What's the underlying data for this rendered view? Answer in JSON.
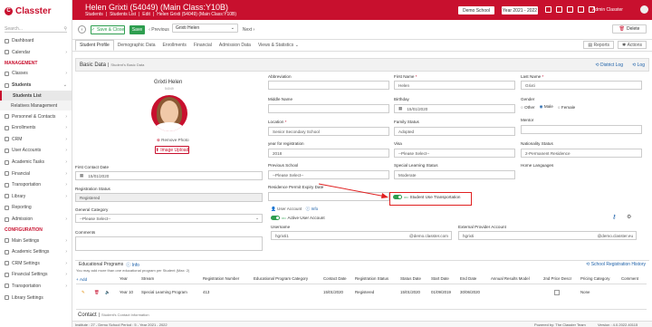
{
  "app": {
    "logo": "Classter",
    "logo_mark": "C"
  },
  "sidebar": {
    "search_placeholder": "Search...",
    "items_top": [
      {
        "label": "Dashboard"
      },
      {
        "label": "Calendar"
      }
    ],
    "section_management": "MANAGEMENT",
    "items_mgmt": [
      {
        "label": "Classes"
      },
      {
        "label": "Students"
      }
    ],
    "students_sub": [
      {
        "label": "Students List"
      },
      {
        "label": "Relatives Management"
      }
    ],
    "items_mgmt2": [
      {
        "label": "Personnel & Contacts"
      },
      {
        "label": "Enrollments"
      },
      {
        "label": "CRM"
      },
      {
        "label": "User Accounts"
      },
      {
        "label": "Academic Tasks"
      },
      {
        "label": "Financial"
      },
      {
        "label": "Transportation"
      },
      {
        "label": "Library"
      },
      {
        "label": "Reporting"
      },
      {
        "label": "Admission"
      }
    ],
    "section_configuration": "CONFIGURATION",
    "items_config": [
      {
        "label": "Main Settings"
      },
      {
        "label": "Academic Settings"
      },
      {
        "label": "CRM Settings"
      },
      {
        "label": "Financial Settings"
      },
      {
        "label": "Transportation"
      },
      {
        "label": "Library Settings"
      }
    ]
  },
  "header": {
    "title": "Helen Grixti (54049) (Main Class:Y10B)",
    "breadcrumb": [
      "Students",
      "Students List",
      "Edit",
      "Helen Grixti (54049) (Main Class:Y10B)"
    ],
    "school": "Demo School",
    "year": "Year 2021 - 2022",
    "user": "Admin Classter"
  },
  "toolbar": {
    "save_close": "Save & Close",
    "save": "Save",
    "previous": "Previous",
    "student_select": "Grixti Helen",
    "next": "Next",
    "delete": "Delete"
  },
  "tabs": [
    "Student Profile",
    "Demographic Data",
    "Enrollments",
    "Financial",
    "Admission Data",
    "Views & Statistics"
  ],
  "tab_right": {
    "reports": "Reports",
    "actions": "Actions"
  },
  "basic": {
    "title": "Basic Data",
    "subtitle": "Student's Basic Data",
    "district_log": "District Log",
    "log": "Log",
    "student_name": "Grixti Helen",
    "student_id": "54049",
    "remove_photo": "Remove Photo",
    "image_upload": "Image Upload",
    "first_contact_label": "First Contact Date",
    "first_contact": "15/01/2020",
    "reg_status_label": "Registration Status",
    "reg_status": "Registered",
    "general_category_label": "General Category",
    "general_category": "--Please Select--",
    "comments_label": "Comments"
  },
  "fields": {
    "abbreviation_label": "Abbreviation",
    "first_name_label": "First Name",
    "first_name": "Helen",
    "last_name_label": "Last Name",
    "last_name": "Grixti",
    "middle_name_label": "Middle Name",
    "birthday_label": "Birthday",
    "birthday": "15/01/2020",
    "gender_label": "Gender",
    "gender_options": [
      "Other",
      "Male",
      "Female"
    ],
    "gender_selected": "Male",
    "location_label": "Location",
    "location": "Senior Secondary School",
    "family_status_label": "Family Status",
    "family_status": "Adopted",
    "mentor_label": "Mentor",
    "year_reg_label": "year for registration",
    "year_reg": "2018",
    "visa_label": "Visa",
    "visa": "--Please Select--",
    "nationality_status_label": "Nationality Status",
    "nationality_status": "2-Permanent Residence",
    "previous_school_label": "Previous School",
    "previous_school": "--Please Select--",
    "special_learning_label": "Special Learning Status",
    "special_learning": "Moderate",
    "home_languages_label": "Home Languages",
    "residence_permit_label": "Residence Permit Expiry Date",
    "transport_label": "Student Use Transportation",
    "toggle_on": "ON"
  },
  "user_account": {
    "title": "User Account",
    "info": "Info",
    "active_label": "Active User Account",
    "username_label": "Username",
    "username": "hgrixti1",
    "domain": "@demo.classter.com",
    "ext_label": "External Provider Account",
    "ext_user": "hgrixti",
    "ext_domain": "@demo.classter.eu"
  },
  "edu": {
    "title": "Educational Programs",
    "info": "Info",
    "note": "You may add more than one educational program per Student (Max: 2)",
    "history": "School Registration History",
    "add": "Add",
    "columns": [
      "Year",
      "Stream",
      "Registration Number",
      "Educational Program Category",
      "Contact Date",
      "Registration Status",
      "Status Date",
      "Start Date",
      "End Date",
      "Annual Results Model",
      "2nd Price Descr",
      "Pricing Category",
      "Comment"
    ],
    "row": [
      "Year 10",
      "Special Learning Program",
      "413",
      "",
      "15/01/2020",
      "Registered",
      "15/01/2020",
      "01/09/2019",
      "30/06/2020",
      "",
      "",
      "None",
      ""
    ]
  },
  "contact": {
    "title": "Contact",
    "subtitle": "Student's Contact Information"
  },
  "footer": {
    "left": "Institute : 27 - Demo School  Period : 5 - Year 2021 - 2022",
    "right": "Powered by: The Classter Team",
    "version": "Version : 4.0.2022.40115"
  }
}
